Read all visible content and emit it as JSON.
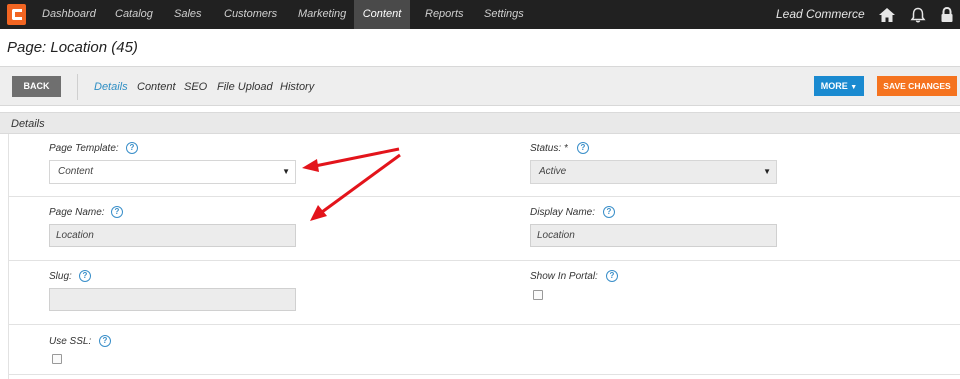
{
  "nav": {
    "items": [
      "Dashboard",
      "Catalog",
      "Sales",
      "Customers",
      "Marketing",
      "Content",
      "Reports",
      "Settings"
    ],
    "active": "Content",
    "brand": "Lead Commerce",
    "icons": [
      "home-icon",
      "bell-icon",
      "lock-icon"
    ],
    "logo_color": "#f26522"
  },
  "page": {
    "title": "Page: Location (45)"
  },
  "toolbar": {
    "back_label": "BACK",
    "tabs": [
      "Details",
      "Content",
      "SEO",
      "File Upload",
      "History"
    ],
    "active_tab": "Details",
    "more_label": "MORE",
    "save_label": "SAVE CHANGES",
    "more_color": "#1a8ad0",
    "save_color": "#f5731f"
  },
  "section": {
    "title": "Details"
  },
  "fields": {
    "page_template": {
      "label": "Page Template:",
      "value": "Content"
    },
    "status": {
      "label": "Status: *",
      "value": "Active"
    },
    "page_name": {
      "label": "Page Name:",
      "value": "Location"
    },
    "display_name": {
      "label": "Display Name:",
      "value": "Location"
    },
    "slug": {
      "label": "Slug:",
      "value": ""
    },
    "show_in_portal": {
      "label": "Show In Portal:",
      "checked": false
    },
    "use_ssl": {
      "label": "Use SSL:",
      "checked": false
    }
  },
  "help_glyph": "?",
  "caret_glyph": "▼",
  "annotation_color": "#e3141b"
}
